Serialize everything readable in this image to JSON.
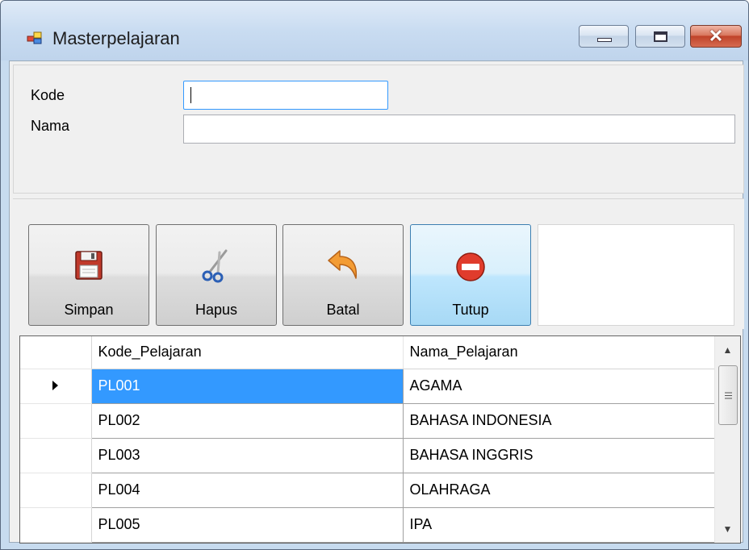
{
  "window": {
    "title": "Masterpelajaran",
    "close_glyph": "✕"
  },
  "form": {
    "kode_label": "Kode",
    "nama_label": "Nama",
    "kode_value": "",
    "nama_value": ""
  },
  "toolbar": {
    "simpan_label": "Simpan",
    "hapus_label": "Hapus",
    "batal_label": "Batal",
    "tutup_label": "Tutup",
    "simpan_icon": "floppy-disk-icon",
    "hapus_icon": "scissors-icon",
    "batal_icon": "undo-arrow-icon",
    "tutup_icon": "stop-sign-icon"
  },
  "grid": {
    "headers": [
      "Kode_Pelajaran",
      "Nama_Pelajaran"
    ],
    "rows": [
      {
        "kode": "PL001",
        "nama": "AGAMA"
      },
      {
        "kode": "PL002",
        "nama": "BAHASA INDONESIA"
      },
      {
        "kode": "PL003",
        "nama": "BAHASA INGGRIS"
      },
      {
        "kode": "PL004",
        "nama": "OLAHRAGA"
      },
      {
        "kode": "PL005",
        "nama": "IPA"
      }
    ],
    "selected_row": 0,
    "scroll_up_glyph": "▲",
    "scroll_down_glyph": "▼"
  },
  "colors": {
    "selection": "#3399ff",
    "focus_border": "#3399ff"
  }
}
